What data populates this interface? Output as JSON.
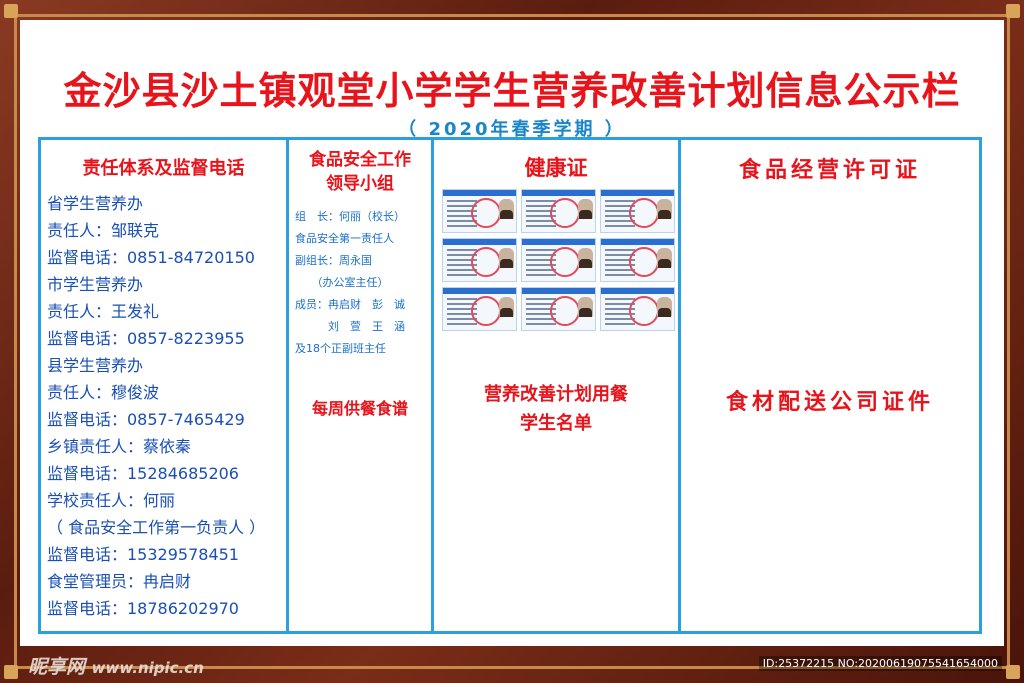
{
  "title": "金沙县沙土镇观堂小学学生营养改善计划信息公示栏",
  "subtitle": "（ 2020年春季学期 ）",
  "col1": {
    "heading": "责任体系及监督电话",
    "lines": [
      "省学生营养办",
      "责任人：邹联克",
      "监督电话：0851-84720150",
      "市学生营养办",
      "责任人：王发礼",
      "监督电话：0857-8223955",
      "县学生营养办",
      "责任人：穆俊波",
      "监督电话：0857-7465429",
      "乡镇责任人：蔡依秦",
      "监督电话：15284685206",
      "学校责任人：何丽",
      "（ 食品安全工作第一负责人 ）",
      "监督电话：15329578451",
      "食堂管理员：冉启财",
      "监督电话：18786202970"
    ]
  },
  "col2": {
    "heading_line1": "食品安全工作",
    "heading_line2": "领导小组",
    "members": [
      "组　长：何丽（校长）",
      "食品安全第一责任人",
      "副组长：周永国",
      "　　（办公室主任）",
      "成员：冉启财　彭　诚",
      "　　　刘　萱　王　涵",
      "及18个正副班主任"
    ],
    "menu_label": "每周供餐食谱"
  },
  "col3": {
    "heading": "健康证",
    "cards": [
      "card1",
      "card2",
      "card3",
      "card4",
      "card5",
      "card6",
      "card7",
      "card8",
      "card9"
    ],
    "roster_line1": "营养改善计划用餐",
    "roster_line2": "学生名单"
  },
  "col4": {
    "heading": "食品经营许可证",
    "heading2": "食材配送公司证件"
  },
  "footer": {
    "watermark": "昵享网",
    "watermark_url": "www.nipic.cn",
    "id_text": "ID:25372215 NO:20200619075541654000"
  },
  "colors": {
    "title": "#e8141b",
    "subtitle": "#1a86c8",
    "panel_border": "#2aa0de",
    "frame": "#6b2414"
  }
}
